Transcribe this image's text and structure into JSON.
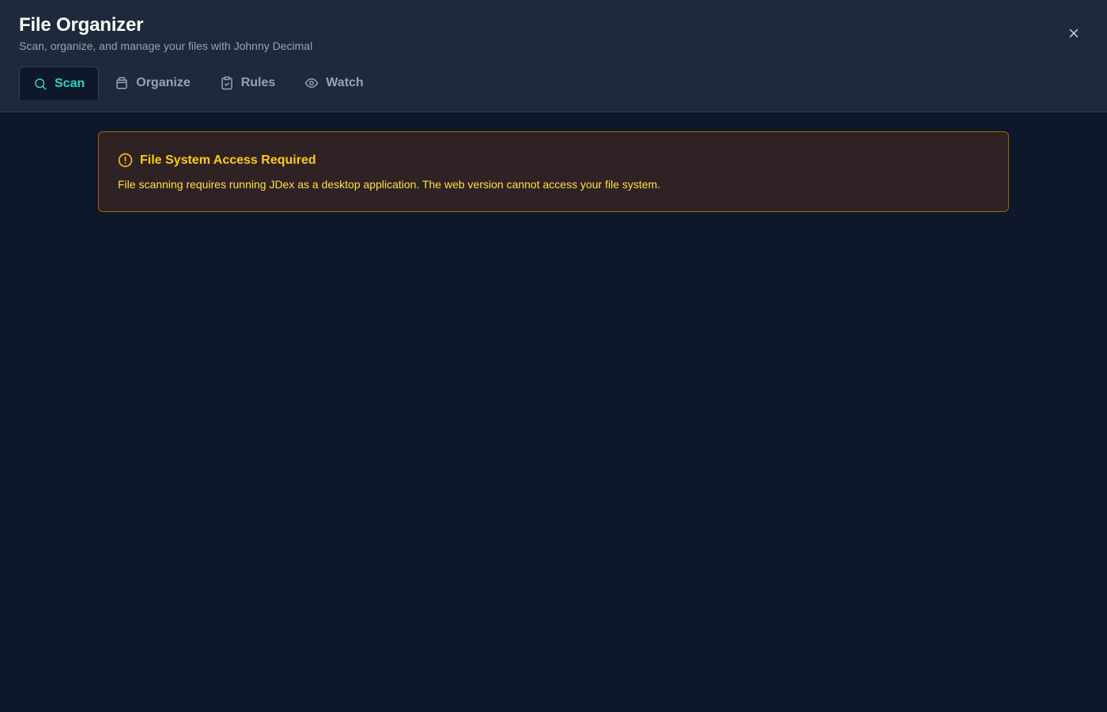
{
  "header": {
    "title": "File Organizer",
    "subtitle": "Scan, organize, and manage your files with Johnny Decimal",
    "close_icon": "close-icon"
  },
  "tabs": [
    {
      "label": "Scan",
      "icon": "search-icon",
      "active": true
    },
    {
      "label": "Organize",
      "icon": "archive-icon",
      "active": false
    },
    {
      "label": "Rules",
      "icon": "clipboard-check-icon",
      "active": false
    },
    {
      "label": "Watch",
      "icon": "eye-icon",
      "active": false
    }
  ],
  "alert": {
    "icon": "alert-circle-icon",
    "title": "File System Access Required",
    "message": "File scanning requires running JDex as a desktop application. The web version cannot access your file system."
  },
  "colors": {
    "background": "#0f172a",
    "header_background": "#1e293b",
    "accent": "#2dd4bf",
    "warning": "#facc15",
    "warning_border": "#a16207"
  }
}
